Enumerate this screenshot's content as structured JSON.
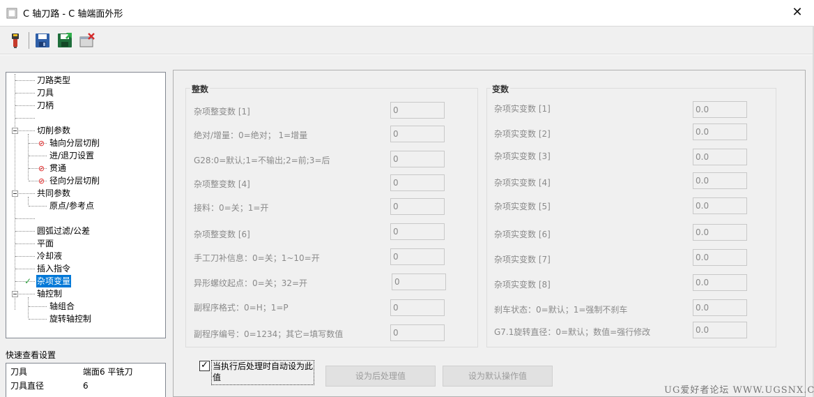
{
  "window": {
    "title": "C 轴刀路 - C 轴端面外形",
    "close_glyph": "✕"
  },
  "toolbar": {
    "icons": [
      "flashlight-icon",
      "save-icon",
      "save-as-icon",
      "delete-icon"
    ]
  },
  "tree": {
    "items": [
      "刀路类型",
      "刀具",
      "刀柄",
      "切削参数",
      "轴向分层切削",
      "进/退刀设置",
      "贯通",
      "径向分层切削",
      "共同参数",
      "原点/参考点",
      "圆弧过滤/公差",
      "平面",
      "冷却液",
      "插入指令",
      "杂项变量",
      "轴控制",
      "轴组合",
      "旋转轴控制"
    ]
  },
  "quick_view": {
    "label": "快速查看设置",
    "rows": [
      {
        "key": "刀具",
        "value": "端面6 平铣刀"
      },
      {
        "key": "刀具直径",
        "value": "6"
      }
    ]
  },
  "integers": {
    "title": "整数",
    "fields": [
      {
        "label": "杂项整变数 [1]",
        "value": "0"
      },
      {
        "label": "绝对/增量：0=绝对； 1=增量",
        "value": "0"
      },
      {
        "label": "G28:0=默认;1=不输出;2=前;3=后",
        "value": "0"
      },
      {
        "label": "杂项整变数 [4]",
        "value": "0"
      },
      {
        "label": "接料：0=关；1=开",
        "value": "0"
      },
      {
        "label": "杂项整变数 [6]",
        "value": "0"
      },
      {
        "label": "手工刀补信息：0=关；1~10=开",
        "value": "0"
      },
      {
        "label": "异形螺纹起点：0=关；32=开",
        "value": "0"
      },
      {
        "label": "副程序格式：0=H；1=P",
        "value": "0"
      },
      {
        "label": "副程序编号：0=1234；其它=填写数值",
        "value": "0"
      }
    ]
  },
  "reals": {
    "title": "变数",
    "fields": [
      {
        "label": "杂项实变数 [1]",
        "value": "0.0"
      },
      {
        "label": "杂项实变数 [2]",
        "value": "0.0"
      },
      {
        "label": "杂项实变数 [3]",
        "value": "0.0"
      },
      {
        "label": "杂项实变数 [4]",
        "value": "0.0"
      },
      {
        "label": "杂项实变数 [5]",
        "value": "0.0"
      },
      {
        "label": "杂项实变数 [6]",
        "value": "0.0"
      },
      {
        "label": "杂项实变数 [7]",
        "value": "0.0"
      },
      {
        "label": "杂项实变数 [8]",
        "value": "0.0"
      },
      {
        "label": "刹车状态：0=默认；1=强制不刹车",
        "value": "0.0"
      },
      {
        "label": "G7.1旋转直径：0=默认；数值=强行修改",
        "value": "0.0"
      }
    ]
  },
  "bottom": {
    "auto_set_checked": true,
    "auto_set_label": "当执行后处理时自动设为此值",
    "set_post_button": "设为后处理值",
    "set_default_button": "设为默认操作值"
  },
  "watermark": "UG爱好者论坛 WWW.UGSNX.COM"
}
